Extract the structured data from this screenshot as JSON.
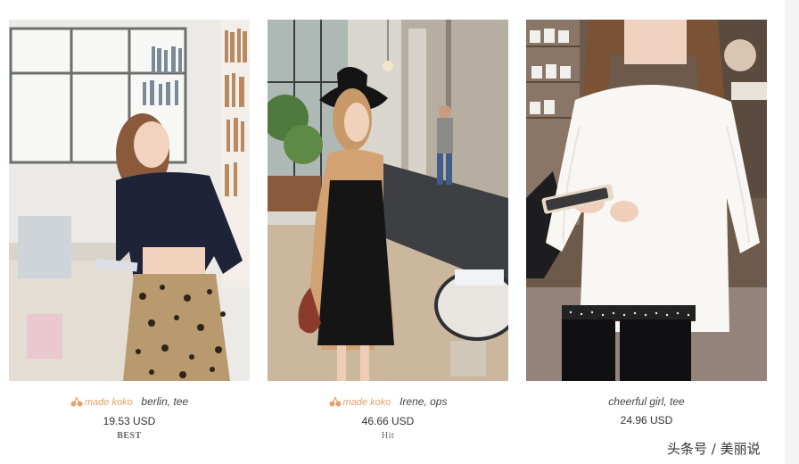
{
  "products": [
    {
      "brand": "made koko",
      "name": "berlin, tee",
      "price": "19.53 USD",
      "badge": "BEST"
    },
    {
      "brand": "made koko",
      "name": "Irene, ops",
      "price": "46.66 USD",
      "badge": "Hit"
    },
    {
      "brand": "",
      "name": "cheerful girl, tee",
      "price": "24.96 USD",
      "badge": ""
    }
  ],
  "icons": {
    "brand": "cherry-icon"
  },
  "colors": {
    "brand_accent": "#e8a06a"
  },
  "watermark": "头条号 / 美丽说"
}
